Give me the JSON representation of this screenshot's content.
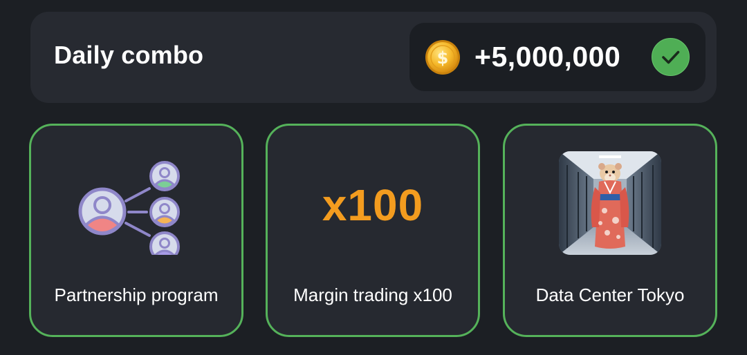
{
  "header": {
    "title": "Daily combo",
    "reward_amount": "+5,000,000",
    "coin_icon": "dollar-coin-icon",
    "status_icon": "check-circle-icon",
    "status_color": "#55b25a",
    "coin_color": "#f5b82a"
  },
  "cards": [
    {
      "label": "Partnership program",
      "icon": "referral-network-icon"
    },
    {
      "label": "Margin trading x100",
      "art_text": "x100",
      "art_color": "#f39c1f"
    },
    {
      "label": "Data Center Tokyo",
      "icon": "hamster-kimono-photo"
    }
  ],
  "colors": {
    "background": "#1c1f24",
    "panel": "#272a31",
    "pill": "#1b1e23",
    "card_border": "#55b25a"
  }
}
